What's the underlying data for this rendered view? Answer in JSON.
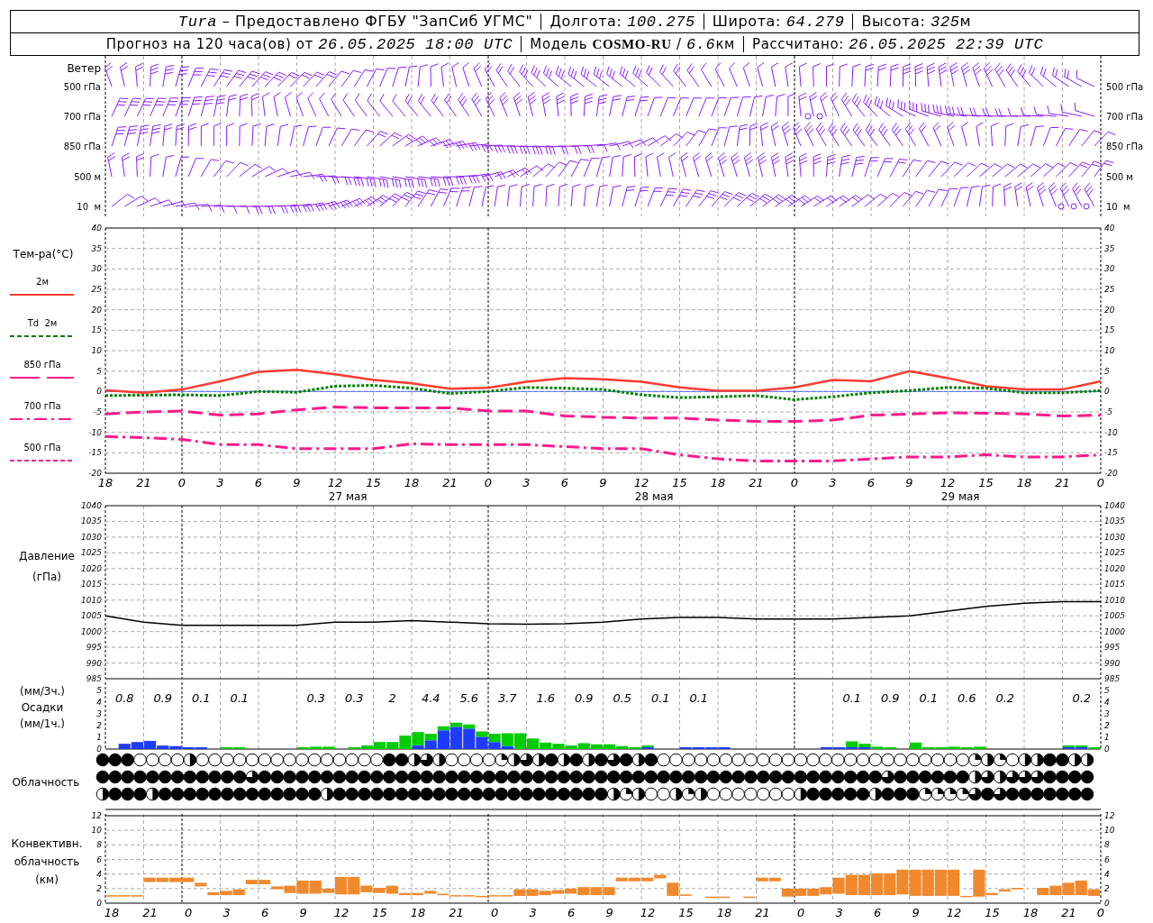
{
  "header": {
    "rows": [
      [
        {
          "text": "*Tura* – Предоставлено ФГБУ \"ЗапСиб УГМС\""
        },
        {
          "text": "Долгота: *100.275*"
        },
        {
          "text": "Широта: *64.279*"
        },
        {
          "text": "Высота: *325*",
          "unit": "м"
        }
      ],
      [
        {
          "text": "Прогноз на 120 часа(ов) от *26.05.2025 18:00 UTC*"
        },
        {
          "text": "Модель **COSMO-RU** / *6.6*",
          "unit": "км"
        },
        {
          "text": "Рассчитано: *26.05.2025 22:39 UTC*"
        }
      ]
    ]
  },
  "wind": {
    "title": "Ветер",
    "levels_left": [
      "500 гПа",
      "700 гПа",
      "850 гПа",
      "500 м",
      "10  м"
    ],
    "levels_right": [
      "500 гПа",
      "700 гПа",
      "850 гПа",
      "500 м",
      "10  м"
    ]
  },
  "temperature": {
    "title": "Тем-ра(°C)",
    "legend": [
      {
        "label": "2м",
        "kind": "solid",
        "color": "#ff3b30"
      },
      {
        "label": "Td  2м",
        "kind": "dashed",
        "color": "#008000"
      },
      {
        "label": "850 гПа",
        "kind": "split",
        "color": "#ff1a8c"
      },
      {
        "label": "700 гПа",
        "kind": "dashdot",
        "color": "#ff1a8c"
      },
      {
        "label": "500 гПа",
        "kind": "dashed",
        "color": "#ff1a8c"
      }
    ],
    "dates": [
      "27 мая",
      "28 мая",
      "29 мая"
    ],
    "right_ticks": [
      "40",
      "35",
      "30",
      "25",
      "20",
      "15",
      "10",
      "5",
      "0",
      "-5",
      "-10",
      "-15",
      "-20"
    ],
    "chart_data": {
      "type": "line",
      "grid": true,
      "ylim": [
        -20,
        40
      ],
      "yticks": [
        -20,
        -15,
        -10,
        -5,
        0,
        5,
        10,
        15,
        20,
        25,
        30,
        35,
        40
      ],
      "ref_lines": [
        {
          "axis": "y",
          "value": 0,
          "color": "#3355ff"
        }
      ],
      "categories": [
        "18",
        "21",
        "0",
        "3",
        "6",
        "9",
        "12",
        "15",
        "18",
        "21",
        "0",
        "3",
        "6",
        "9",
        "12",
        "15",
        "18",
        "21",
        "0",
        "3",
        "6",
        "9",
        "12",
        "15",
        "18",
        "21",
        "0"
      ],
      "series": [
        {
          "color": "#ff3b30",
          "line_style": "solid",
          "values": [
            0.3,
            -0.3,
            0.5,
            2.5,
            4.8,
            5.3,
            4.2,
            2.8,
            2,
            0.7,
            0.9,
            2.4,
            3.3,
            3,
            2.4,
            1,
            0.2,
            0.2,
            1,
            2.8,
            2.5,
            5,
            3.3,
            1.3,
            0.5,
            0.5,
            2.5
          ]
        },
        {
          "color": "#008000",
          "line_style": "dotted",
          "values": [
            -1,
            -0.9,
            -0.8,
            -1,
            0,
            -0.2,
            1.3,
            1.5,
            0.8,
            -0.5,
            0,
            1,
            0.8,
            0.5,
            -0.8,
            -1.5,
            -1.3,
            -1,
            -2,
            -1.3,
            -0.3,
            0.2,
            1,
            0.8,
            -0.3,
            -0.3,
            0.2
          ]
        },
        {
          "color": "#ff1a8c",
          "line_style": "dashed",
          "values": [
            -5.5,
            -5,
            -4.8,
            -5.8,
            -5.5,
            -4.5,
            -3.8,
            -4,
            -4,
            -4,
            -4.8,
            -4.8,
            -6,
            -6.3,
            -6.5,
            -6.5,
            -7,
            -7.3,
            -7.3,
            -7,
            -5.8,
            -5.5,
            -5.2,
            -5.3,
            -5.5,
            -6,
            -5.8
          ]
        },
        {
          "color": "#ff1a8c",
          "line_style": "dashdot",
          "values": [
            -11,
            -11.3,
            -11.7,
            -13,
            -13,
            -14,
            -14,
            -14,
            -12.8,
            -13,
            -13,
            -13,
            -13.5,
            -14,
            -14,
            -15.5,
            -16.5,
            -17,
            -17,
            -17,
            -16.5,
            -16,
            -16,
            -15.5,
            -16,
            -16,
            -15.5
          ]
        }
      ]
    }
  },
  "pressure": {
    "title": [
      "Давление",
      "(гПа)"
    ],
    "right_ticks": [
      "1040",
      "1035",
      "1030",
      "1025",
      "1020",
      "1015",
      "1010",
      "1005",
      "1000",
      "995",
      "990",
      "985"
    ],
    "chart_data": {
      "type": "line",
      "grid": true,
      "ylim": [
        985,
        1040
      ],
      "yticks": [
        985,
        990,
        995,
        1000,
        1005,
        1010,
        1015,
        1020,
        1025,
        1030,
        1035,
        1040
      ],
      "series": [
        {
          "color": "#000000",
          "values": [
            1005,
            1003,
            1002,
            1002,
            1002,
            1002,
            1003,
            1003,
            1003.5,
            1003,
            1002.5,
            1002.3,
            1002.5,
            1003,
            1004,
            1004.5,
            1004.5,
            1004,
            1004,
            1004,
            1004.5,
            1005,
            1006.5,
            1008,
            1009,
            1009.5,
            1009.5
          ]
        }
      ]
    }
  },
  "precipitation": {
    "title": [
      "(мм/3ч.)",
      "Осадки",
      "(мм/1ч.)"
    ],
    "right_ticks": [
      "5",
      "4",
      "3",
      "2",
      "1",
      "0"
    ],
    "totals": [
      {
        "kind": "total",
        "text": "0.8"
      },
      {
        "kind": "total",
        "text": "0.9"
      },
      {
        "kind": "total",
        "text": "0.1"
      },
      {
        "kind": "total",
        "text": "0.1"
      },
      {
        "kind": "blank"
      },
      {
        "kind": "total",
        "text": "0.3"
      },
      {
        "kind": "total",
        "text": "0.3"
      },
      {
        "kind": "total",
        "text": "2"
      },
      {
        "kind": "total",
        "text": "4.4"
      },
      {
        "kind": "total",
        "text": "5.6"
      },
      {
        "kind": "total",
        "text": "3.7"
      },
      {
        "kind": "total",
        "text": "1.6"
      },
      {
        "kind": "total",
        "text": "0.9"
      },
      {
        "kind": "total",
        "text": "0.5"
      },
      {
        "kind": "total",
        "text": "0.1"
      },
      {
        "kind": "total",
        "text": "0.1"
      },
      {
        "kind": "blank"
      },
      {
        "kind": "blank"
      },
      {
        "kind": "blank"
      },
      {
        "kind": "total",
        "text": "0.1"
      },
      {
        "kind": "total",
        "text": "0.9"
      },
      {
        "kind": "total",
        "text": "0.1"
      },
      {
        "kind": "total",
        "text": "0.6"
      },
      {
        "kind": "total",
        "text": "0.2"
      },
      {
        "kind": "blank"
      },
      {
        "kind": "total",
        "text": "0.2"
      }
    ],
    "chart_data": {
      "type": "bar",
      "stacked": true,
      "ylim": [
        0,
        5.7
      ],
      "yticks": [
        0,
        1,
        2,
        3,
        4,
        5
      ],
      "series": [
        {
          "color": "#1e3cff",
          "values": [
            0,
            0.45,
            0.6,
            0.7,
            0.3,
            0.25,
            0.15,
            0.15,
            0,
            0,
            0,
            0,
            0,
            0,
            0,
            0,
            0,
            0,
            0,
            0,
            0,
            0,
            0,
            0,
            0.3,
            0.75,
            1.6,
            1.9,
            1.75,
            1.05,
            0.6,
            0.25,
            0,
            0,
            0,
            0,
            0,
            0,
            0,
            0,
            0,
            0,
            0.05,
            0,
            0,
            0.05,
            0.1,
            0.1,
            0.05,
            0,
            0,
            0,
            0,
            0,
            0,
            0,
            0.05,
            0.05,
            0.15,
            0.1,
            0,
            0,
            0,
            0,
            0,
            0,
            0,
            0,
            0,
            0,
            0,
            0,
            0,
            0,
            0,
            0.15,
            0.15,
            0
          ]
        },
        {
          "color": "#00cc00",
          "values": [
            0,
            0,
            0,
            0,
            0,
            0,
            0,
            0,
            0,
            0.15,
            0.1,
            0,
            0,
            0,
            0,
            0.15,
            0.2,
            0.2,
            0,
            0.15,
            0.3,
            0.6,
            0.6,
            1.15,
            1.15,
            0.55,
            0.35,
            0.35,
            0.35,
            0.45,
            0.7,
            1.1,
            1.35,
            0.9,
            0.55,
            0.45,
            0.3,
            0.5,
            0.4,
            0.4,
            0.25,
            0.15,
            0.1,
            0,
            0,
            0,
            0,
            0,
            0,
            0,
            0,
            0,
            0,
            0,
            0,
            0,
            0,
            0,
            0.5,
            0.3,
            0.2,
            0.05,
            0,
            0.55,
            0.15,
            0.15,
            0.2,
            0.05,
            0.2,
            0,
            0,
            0,
            0,
            0,
            0,
            0.05,
            0.05,
            0.05
          ]
        }
      ]
    }
  },
  "cloud_cover": {
    "title": "Облачность",
    "rows": [
      {
        "symbols": [
          {
            "kind": "overcast"
          },
          {
            "kind": "overcast"
          },
          {
            "kind": "overcast"
          },
          {
            "kind": "clear"
          },
          {
            "kind": "clear"
          },
          {
            "kind": "clear"
          },
          {
            "kind": "clear"
          },
          {
            "kind": "half"
          },
          {
            "kind": "clear"
          },
          {
            "kind": "clear"
          },
          {
            "kind": "clear"
          },
          {
            "kind": "clear"
          },
          {
            "kind": "clear"
          },
          {
            "kind": "clear"
          },
          {
            "kind": "clear"
          },
          {
            "kind": "clear"
          },
          {
            "kind": "clear"
          },
          {
            "kind": "clear"
          },
          {
            "kind": "clear"
          },
          {
            "kind": "clear"
          },
          {
            "kind": "clear"
          },
          {
            "kind": "clear"
          },
          {
            "kind": "clear"
          },
          {
            "kind": "overcast"
          },
          {
            "kind": "overcast"
          },
          {
            "kind": "half"
          },
          {
            "kind": "most"
          },
          {
            "kind": "half"
          },
          {
            "kind": "clear"
          },
          {
            "kind": "clear"
          },
          {
            "kind": "clear"
          },
          {
            "kind": "clear"
          },
          {
            "kind": "quarter"
          },
          {
            "kind": "half"
          },
          {
            "kind": "most"
          },
          {
            "kind": "half"
          },
          {
            "kind": "overcast"
          },
          {
            "kind": "half"
          },
          {
            "kind": "overcast"
          },
          {
            "kind": "half"
          },
          {
            "kind": "overcast"
          },
          {
            "kind": "most"
          },
          {
            "kind": "overcast"
          },
          {
            "kind": "half"
          },
          {
            "kind": "overcast"
          },
          {
            "kind": "clear"
          },
          {
            "kind": "clear"
          },
          {
            "kind": "clear"
          },
          {
            "kind": "clear"
          },
          {
            "kind": "clear"
          },
          {
            "kind": "clear"
          },
          {
            "kind": "clear"
          },
          {
            "kind": "clear"
          },
          {
            "kind": "clear"
          },
          {
            "kind": "clear"
          },
          {
            "kind": "clear"
          },
          {
            "kind": "clear"
          },
          {
            "kind": "clear"
          },
          {
            "kind": "clear"
          },
          {
            "kind": "clear"
          },
          {
            "kind": "clear"
          },
          {
            "kind": "clear"
          },
          {
            "kind": "clear"
          },
          {
            "kind": "clear"
          },
          {
            "kind": "clear"
          },
          {
            "kind": "clear"
          },
          {
            "kind": "clear"
          },
          {
            "kind": "clear"
          },
          {
            "kind": "clear"
          },
          {
            "kind": "clear"
          },
          {
            "kind": "quarter"
          },
          {
            "kind": "half"
          },
          {
            "kind": "quarter"
          },
          {
            "kind": "clear"
          },
          {
            "kind": "half"
          },
          {
            "kind": "half"
          },
          {
            "kind": "overcast"
          },
          {
            "kind": "overcast"
          },
          {
            "kind": "half"
          },
          {
            "kind": "half"
          }
        ]
      },
      {
        "symbols": [
          {
            "kind": "overcast"
          },
          {
            "kind": "overcast"
          },
          {
            "kind": "overcast"
          },
          {
            "kind": "overcast"
          },
          {
            "kind": "overcast"
          },
          {
            "kind": "overcast"
          },
          {
            "kind": "overcast"
          },
          {
            "kind": "overcast"
          },
          {
            "kind": "overcast"
          },
          {
            "kind": "overcast"
          },
          {
            "kind": "overcast"
          },
          {
            "kind": "overcast"
          },
          {
            "kind": "most"
          },
          {
            "kind": "overcast"
          },
          {
            "kind": "overcast"
          },
          {
            "kind": "overcast"
          },
          {
            "kind": "overcast"
          },
          {
            "kind": "overcast"
          },
          {
            "kind": "overcast"
          },
          {
            "kind": "overcast"
          },
          {
            "kind": "overcast"
          },
          {
            "kind": "overcast"
          },
          {
            "kind": "overcast"
          },
          {
            "kind": "overcast"
          },
          {
            "kind": "overcast"
          },
          {
            "kind": "overcast"
          },
          {
            "kind": "overcast"
          },
          {
            "kind": "overcast"
          },
          {
            "kind": "overcast"
          },
          {
            "kind": "overcast"
          },
          {
            "kind": "overcast"
          },
          {
            "kind": "overcast"
          },
          {
            "kind": "overcast"
          },
          {
            "kind": "overcast"
          },
          {
            "kind": "overcast"
          },
          {
            "kind": "overcast"
          },
          {
            "kind": "overcast"
          },
          {
            "kind": "overcast"
          },
          {
            "kind": "overcast"
          },
          {
            "kind": "overcast"
          },
          {
            "kind": "overcast"
          },
          {
            "kind": "overcast"
          },
          {
            "kind": "overcast"
          },
          {
            "kind": "overcast"
          },
          {
            "kind": "overcast"
          },
          {
            "kind": "overcast"
          },
          {
            "kind": "overcast"
          },
          {
            "kind": "overcast"
          },
          {
            "kind": "overcast"
          },
          {
            "kind": "overcast"
          },
          {
            "kind": "overcast"
          },
          {
            "kind": "overcast"
          },
          {
            "kind": "overcast"
          },
          {
            "kind": "overcast"
          },
          {
            "kind": "overcast"
          },
          {
            "kind": "overcast"
          },
          {
            "kind": "overcast"
          },
          {
            "kind": "overcast"
          },
          {
            "kind": "overcast"
          },
          {
            "kind": "overcast"
          },
          {
            "kind": "overcast"
          },
          {
            "kind": "overcast"
          },
          {
            "kind": "overcast"
          },
          {
            "kind": "most"
          },
          {
            "kind": "overcast"
          },
          {
            "kind": "overcast"
          },
          {
            "kind": "overcast"
          },
          {
            "kind": "overcast"
          },
          {
            "kind": "overcast"
          },
          {
            "kind": "overcast"
          },
          {
            "kind": "half"
          },
          {
            "kind": "most"
          },
          {
            "kind": "half"
          },
          {
            "kind": "most"
          },
          {
            "kind": "most"
          },
          {
            "kind": "most"
          },
          {
            "kind": "overcast"
          },
          {
            "kind": "overcast"
          },
          {
            "kind": "overcast"
          },
          {
            "kind": "overcast"
          }
        ]
      },
      {
        "symbols": [
          {
            "kind": "half"
          },
          {
            "kind": "overcast"
          },
          {
            "kind": "overcast"
          },
          {
            "kind": "overcast"
          },
          {
            "kind": "half"
          },
          {
            "kind": "overcast"
          },
          {
            "kind": "overcast"
          },
          {
            "kind": "overcast"
          },
          {
            "kind": "overcast"
          },
          {
            "kind": "overcast"
          },
          {
            "kind": "overcast"
          },
          {
            "kind": "overcast"
          },
          {
            "kind": "overcast"
          },
          {
            "kind": "overcast"
          },
          {
            "kind": "overcast"
          },
          {
            "kind": "overcast"
          },
          {
            "kind": "overcast"
          },
          {
            "kind": "overcast"
          },
          {
            "kind": "half"
          },
          {
            "kind": "overcast"
          },
          {
            "kind": "overcast"
          },
          {
            "kind": "overcast"
          },
          {
            "kind": "overcast"
          },
          {
            "kind": "overcast"
          },
          {
            "kind": "overcast"
          },
          {
            "kind": "overcast"
          },
          {
            "kind": "overcast"
          },
          {
            "kind": "overcast"
          },
          {
            "kind": "overcast"
          },
          {
            "kind": "overcast"
          },
          {
            "kind": "overcast"
          },
          {
            "kind": "overcast"
          },
          {
            "kind": "overcast"
          },
          {
            "kind": "overcast"
          },
          {
            "kind": "overcast"
          },
          {
            "kind": "overcast"
          },
          {
            "kind": "overcast"
          },
          {
            "kind": "overcast"
          },
          {
            "kind": "overcast"
          },
          {
            "kind": "overcast"
          },
          {
            "kind": "overcast"
          },
          {
            "kind": "half"
          },
          {
            "kind": "quarter"
          },
          {
            "kind": "half"
          },
          {
            "kind": "clear"
          },
          {
            "kind": "clear"
          },
          {
            "kind": "half"
          },
          {
            "kind": "quarter"
          },
          {
            "kind": "half"
          },
          {
            "kind": "clear"
          },
          {
            "kind": "clear"
          },
          {
            "kind": "clear"
          },
          {
            "kind": "clear"
          },
          {
            "kind": "clear"
          },
          {
            "kind": "clear"
          },
          {
            "kind": "clear"
          },
          {
            "kind": "half"
          },
          {
            "kind": "overcast"
          },
          {
            "kind": "overcast"
          },
          {
            "kind": "overcast"
          },
          {
            "kind": "overcast"
          },
          {
            "kind": "overcast"
          },
          {
            "kind": "half"
          },
          {
            "kind": "overcast"
          },
          {
            "kind": "overcast"
          },
          {
            "kind": "overcast"
          },
          {
            "kind": "quarter"
          },
          {
            "kind": "quarter"
          },
          {
            "kind": "quarter"
          },
          {
            "kind": "quarter"
          },
          {
            "kind": "most"
          },
          {
            "kind": "overcast"
          },
          {
            "kind": "most"
          },
          {
            "kind": "overcast"
          },
          {
            "kind": "overcast"
          },
          {
            "kind": "overcast"
          },
          {
            "kind": "overcast"
          },
          {
            "kind": "overcast"
          },
          {
            "kind": "overcast"
          },
          {
            "kind": "overcast"
          }
        ]
      }
    ]
  },
  "convective": {
    "title": [
      "Конвективн.",
      "облачность",
      "(км)"
    ],
    "right_ticks": [
      "12",
      "10",
      "8",
      "6",
      "4",
      "2",
      "0"
    ],
    "end_label": "0",
    "chart_data": {
      "type": "candlestick",
      "grid": true,
      "ylim": [
        0,
        12
      ],
      "yticks": [
        0,
        2,
        4,
        6,
        8,
        10,
        12
      ],
      "categories": [
        "18",
        null,
        null,
        "21",
        null,
        null,
        "0",
        null,
        null,
        "3",
        null,
        null,
        "6",
        null,
        null,
        "9",
        null,
        null,
        "12",
        null,
        null,
        "15",
        null,
        null,
        "18",
        null,
        null,
        "21",
        null,
        null,
        "0",
        null,
        null,
        "3",
        null,
        null,
        "6",
        null,
        null,
        "9",
        null,
        null,
        "12",
        null,
        null,
        "15",
        null,
        null,
        "18",
        null,
        null,
        "21",
        null,
        null,
        "0",
        null,
        null,
        "3",
        null,
        null,
        "6",
        null,
        null,
        "9",
        null,
        null,
        "12",
        null,
        null,
        "15",
        null,
        null,
        "18",
        null,
        null,
        "21",
        null,
        null
      ],
      "series": [
        {
          "color": "#f0892e",
          "ohlc": [
            [
              0.9,
              1.1,
              0.9,
              1.1
            ],
            [
              0.9,
              1.1,
              0.9,
              1.1
            ],
            [
              0.9,
              1.1,
              0.9,
              1.1
            ],
            [
              2.9,
              3.5,
              2.9,
              3.5
            ],
            [
              2.9,
              3.5,
              2.9,
              3.5
            ],
            [
              2.9,
              3.5,
              2.9,
              3.5
            ],
            [
              2.9,
              3.5,
              2.9,
              3.5
            ],
            [
              2.3,
              2.8,
              2.3,
              2.8
            ],
            [
              1.1,
              1.5,
              1.1,
              1.5
            ],
            [
              1.1,
              1.7,
              1.1,
              1.7
            ],
            [
              1.1,
              1.9,
              1.1,
              1.9
            ],
            [
              2.6,
              3.2,
              2.6,
              3.2
            ],
            [
              2.6,
              3.2,
              2.6,
              3.2
            ],
            [
              1.9,
              2.3,
              1.9,
              2.3
            ],
            [
              1.4,
              2.4,
              1.4,
              2.4
            ],
            [
              1.3,
              3.1,
              1.3,
              3.1
            ],
            [
              1.3,
              3.1,
              1.3,
              3.1
            ],
            [
              1.4,
              2.0,
              1.4,
              2.0
            ],
            [
              1.2,
              3.6,
              1.2,
              3.6
            ],
            [
              1.2,
              3.6,
              1.2,
              3.6
            ],
            [
              1.5,
              2.4,
              1.5,
              2.4
            ],
            [
              1.4,
              2.1,
              1.4,
              2.1
            ],
            [
              1.3,
              2.4,
              1.3,
              2.4
            ],
            [
              1.1,
              1.4,
              1.1,
              1.4
            ],
            [
              1.1,
              1.4,
              1.1,
              1.4
            ],
            [
              1.3,
              1.7,
              1.3,
              1.7
            ],
            [
              1.1,
              1.3,
              1.1,
              1.3
            ],
            [
              1.0,
              1.1,
              1.0,
              1.1
            ],
            [
              1.0,
              1.1,
              1.0,
              1.1
            ],
            [
              0.9,
              1.0,
              0.9,
              1.0
            ],
            [
              1.0,
              1.1,
              1.0,
              1.1
            ],
            [
              1.0,
              1.1,
              1.0,
              1.1
            ],
            [
              1.0,
              1.9,
              1.0,
              1.9
            ],
            [
              1.0,
              1.9,
              1.0,
              1.9
            ],
            [
              1.1,
              1.7,
              1.1,
              1.7
            ],
            [
              1.3,
              1.8,
              1.3,
              1.8
            ],
            [
              1.3,
              2.0,
              1.3,
              2.0
            ],
            [
              1.1,
              2.2,
              1.1,
              2.2
            ],
            [
              1.1,
              2.2,
              1.1,
              2.2
            ],
            [
              1.1,
              2.2,
              1.1,
              2.2
            ],
            [
              3.0,
              3.5,
              3.0,
              3.5
            ],
            [
              3.0,
              3.5,
              3.0,
              3.5
            ],
            [
              3.0,
              3.5,
              3.0,
              3.5
            ],
            [
              3.4,
              3.9,
              3.4,
              3.9
            ],
            [
              1.0,
              2.8,
              1.0,
              2.8
            ],
            [
              1.0,
              1.2,
              1.0,
              1.2
            ],
            null,
            [
              0.8,
              0.9,
              0.8,
              0.9
            ],
            [
              0.8,
              0.9,
              0.8,
              0.9
            ],
            null,
            [
              0.8,
              0.9,
              0.8,
              0.9
            ],
            [
              3.0,
              3.5,
              3.0,
              3.5
            ],
            [
              3.0,
              3.5,
              3.0,
              3.5
            ],
            [
              0.9,
              2.0,
              0.9,
              2.0
            ],
            [
              1.0,
              2.0,
              1.0,
              2.0
            ],
            [
              1.0,
              2.0,
              1.0,
              2.0
            ],
            [
              1.2,
              2.2,
              1.2,
              2.2
            ],
            [
              1.3,
              3.5,
              1.3,
              3.5
            ],
            [
              1.1,
              3.9,
              1.1,
              3.9
            ],
            [
              1.1,
              3.9,
              1.1,
              3.9
            ],
            [
              1.1,
              4.1,
              1.1,
              4.1
            ],
            [
              1.1,
              4.1,
              1.1,
              4.1
            ],
            [
              1.2,
              4.6,
              1.2,
              4.6
            ],
            [
              1.0,
              4.6,
              1.0,
              4.6
            ],
            [
              1.0,
              4.6,
              1.0,
              4.6
            ],
            [
              1.0,
              4.6,
              1.0,
              4.6
            ],
            [
              1.0,
              4.6,
              1.0,
              4.6
            ],
            [
              0.9,
              1.0,
              0.9,
              1.0
            ],
            [
              0.9,
              4.6,
              0.9,
              4.6
            ],
            [
              1.1,
              1.4,
              1.1,
              1.4
            ],
            [
              1.6,
              1.9,
              1.6,
              1.9
            ],
            [
              1.9,
              2.1,
              1.9,
              2.1
            ],
            null,
            [
              1.1,
              2.1,
              1.1,
              2.1
            ],
            [
              1.1,
              2.4,
              1.1,
              2.4
            ],
            [
              1.1,
              2.8,
              1.1,
              2.8
            ],
            [
              1.1,
              3.1,
              1.1,
              3.1
            ],
            [
              1.0,
              1.9,
              1.0,
              1.9
            ]
          ]
        }
      ]
    }
  }
}
